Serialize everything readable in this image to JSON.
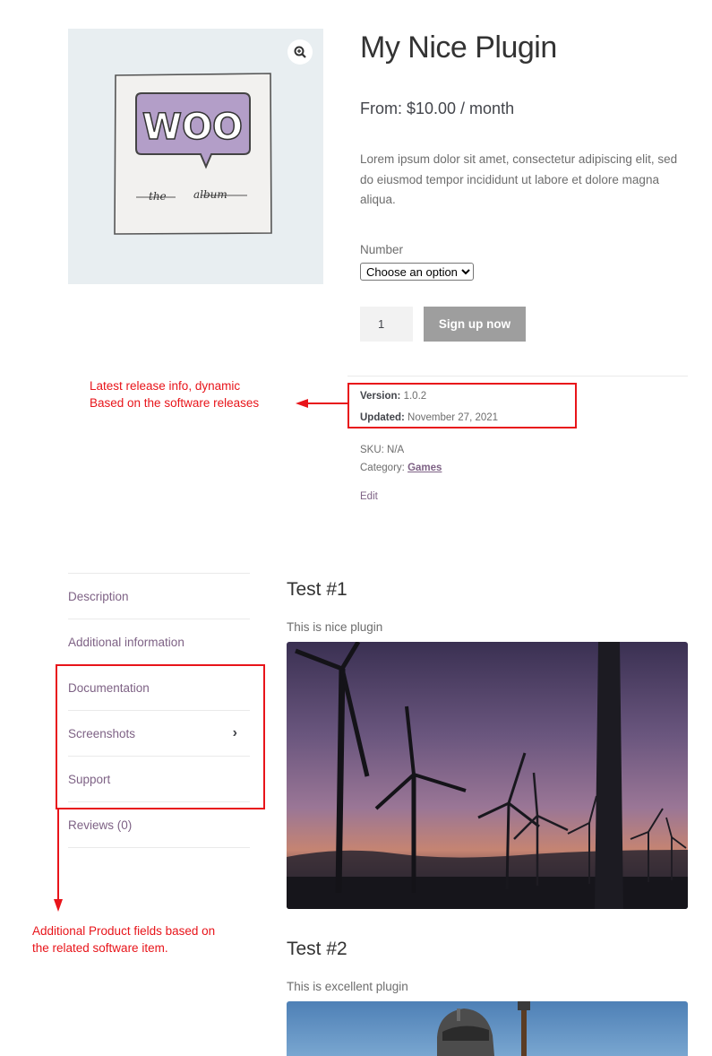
{
  "product": {
    "title": "My Nice Plugin",
    "price": "From: $10.00 / month",
    "short_description": "Lorem ipsum dolor sit amet, consectetur adipiscing elit, sed do eiusmod tempor incididunt ut labore et dolore magna aliqua.",
    "image_text": {
      "logo": "WOO",
      "subtitle_left": "the",
      "subtitle_right": "album"
    }
  },
  "variation": {
    "label": "Number",
    "selected": "Choose an option"
  },
  "cart": {
    "quantity": "1",
    "button_label": "Sign up now"
  },
  "release": {
    "version_label": "Version:",
    "version": "1.0.2",
    "updated_label": "Updated:",
    "updated": "November 27, 2021"
  },
  "meta": {
    "sku_label": "SKU:",
    "sku": "N/A",
    "category_label": "Category:",
    "category": "Games",
    "edit_label": "Edit"
  },
  "annotations": {
    "release_line1": "Latest release info, dynamic",
    "release_line2": "Based on the software releases",
    "fields_line1": "Additional Product fields based on",
    "fields_line2": "the related software item."
  },
  "tabs": [
    {
      "label": "Description"
    },
    {
      "label": "Additional information"
    },
    {
      "label": "Documentation"
    },
    {
      "label": "Screenshots"
    },
    {
      "label": "Support"
    },
    {
      "label": "Reviews (0)"
    }
  ],
  "content": {
    "sections": [
      {
        "title": "Test #1",
        "description": "This is nice plugin"
      },
      {
        "title": "Test #2",
        "description": "This is excellent plugin"
      }
    ]
  },
  "colors": {
    "accent": "#7e6285",
    "annotation": "#e8141a",
    "button": "#9e9e9e"
  }
}
